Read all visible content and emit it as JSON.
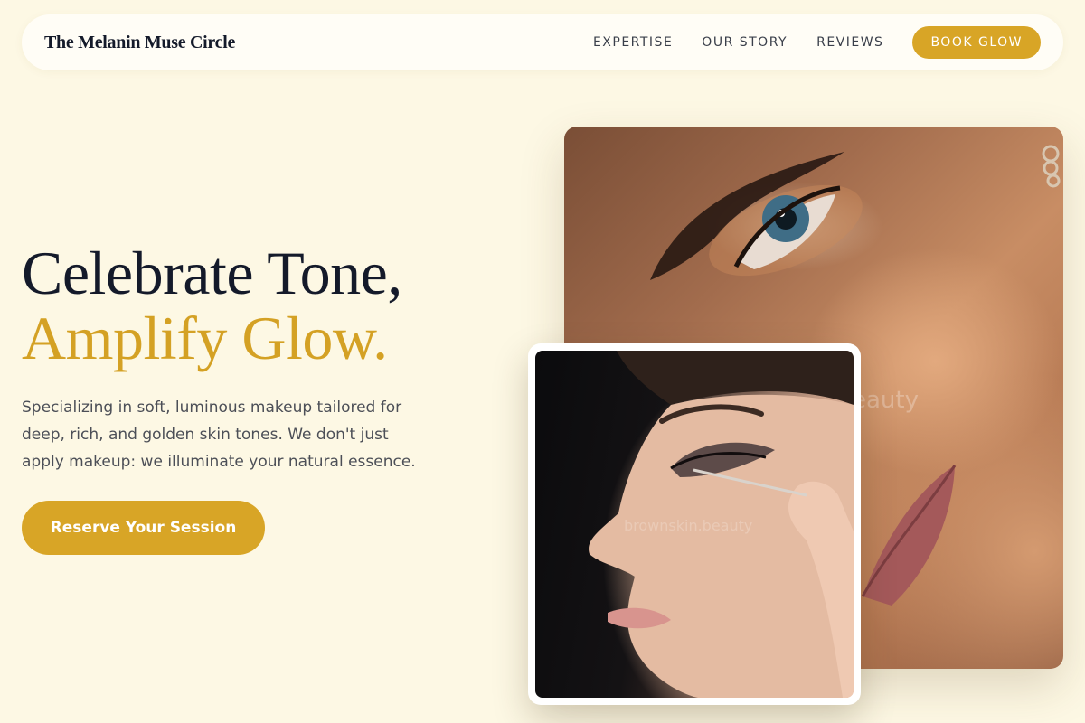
{
  "nav": {
    "brand": "The Melanin Muse Circle",
    "links": [
      "EXPERTISE",
      "OUR STORY",
      "REVIEWS"
    ],
    "cta": "BOOK GLOW"
  },
  "hero": {
    "headline_line1": "Celebrate Tone,",
    "headline_line2": "Amplify Glow.",
    "description": "Specializing in soft, luminous makeup tailored for deep, rich, and golden skin tones. We don't just apply makeup: we illuminate your natural essence.",
    "cta": "Reserve Your Session"
  },
  "images": {
    "main_watermark": "eauty",
    "inset_watermark": "brownskin.beauty"
  },
  "colors": {
    "background": "#fdf8e4",
    "accent_gold": "#d8a526",
    "headline_dark": "#141a2a",
    "body_text": "#4c4f57"
  }
}
